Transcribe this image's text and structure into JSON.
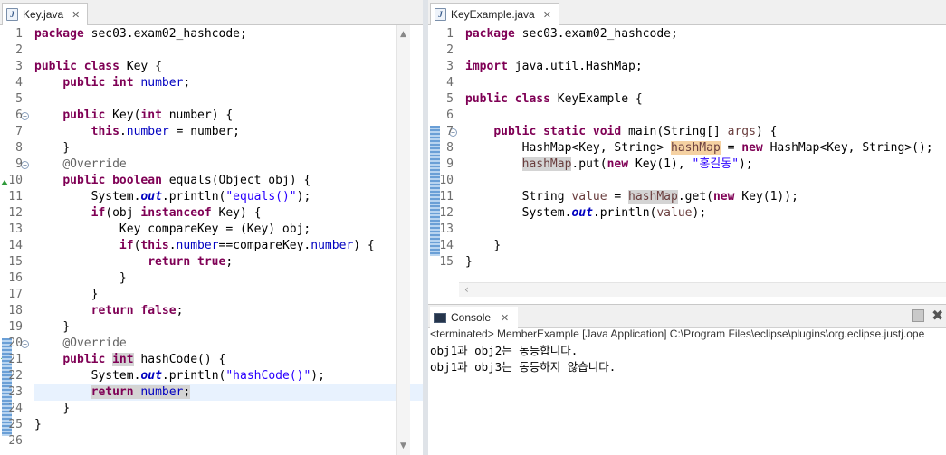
{
  "left_editor": {
    "tab_label": "Key.java",
    "line_numbers": [
      "1",
      "2",
      "3",
      "4",
      "5",
      "6",
      "7",
      "8",
      "9",
      "10",
      "11",
      "12",
      "13",
      "14",
      "15",
      "16",
      "17",
      "18",
      "19",
      "20",
      "21",
      "22",
      "23",
      "24",
      "25",
      "26"
    ]
  },
  "right_editor": {
    "tab_label": "KeyExample.java",
    "line_numbers": [
      "1",
      "2",
      "3",
      "4",
      "5",
      "6",
      "7",
      "8",
      "9",
      "10",
      "11",
      "12",
      "13",
      "14",
      "15"
    ]
  },
  "console": {
    "tab_label": "Console",
    "status": "<terminated> MemberExample [Java Application] C:\\Program Files\\eclipse\\plugins\\org.eclipse.justj.ope",
    "output_lines": [
      "obj1과 obj2는 동등합니다.",
      "obj1과 obj3는 동등하지 않습니다."
    ]
  },
  "tokens": {
    "package": "package",
    "import": "import",
    "public": "public",
    "class": "class",
    "int": "int",
    "this": "this",
    "boolean": "boolean",
    "if": "if",
    "instanceof": "instanceof",
    "return": "return",
    "true": "true",
    "false": "false",
    "static": "static",
    "void": "void",
    "new": "new",
    "override": "@Override",
    "number": "number",
    "out": "out",
    "pkg_name": " sec03.exam02_hashcode;",
    "key_class_rest": " Key {",
    "number_decl_end": ";",
    "ctor_open": " Key(",
    "ctor_param": " number) {",
    "assign": " = number;",
    "close_brace": "}",
    "equals_sig_rest": " equals(Object obj) {",
    "system": "System.",
    "println_open": ".println(",
    "str_equals": "\"equals()\"",
    "close_stmt": ");",
    "if_obj": "(obj ",
    "key_close": " Key) {",
    "cast_line": "Key compareKey = (Key) obj;",
    "if_open": "(",
    "dot": ".",
    "eqeq_cmp": "==compareKey.",
    "close_cond": ") {",
    "true_semicolon": ";",
    "hashcode_sig": " hashCode() {",
    "str_hashcode": "\"hashCode()\"",
    "semicolon": ";",
    "util_import": " java.util.HashMap;",
    "keyexample_rest": " KeyExample {",
    "main_sig": " main(String[] ",
    "args": "args",
    "main_close": ") {",
    "hm_type": "HashMap<Key, String> ",
    "hashMap": "hashMap",
    "eq": " = ",
    "hm_ctor": " HashMap<Key, String>();",
    "put_open": ".put(",
    "key1": " Key(1), ",
    "str_name": "\"홍길동\"",
    "string_decl": "String ",
    "value": "value",
    "get_open": ".get(",
    "key1_close": " Key(1));",
    "value_close": "value",
    "paren_semi": ");"
  }
}
